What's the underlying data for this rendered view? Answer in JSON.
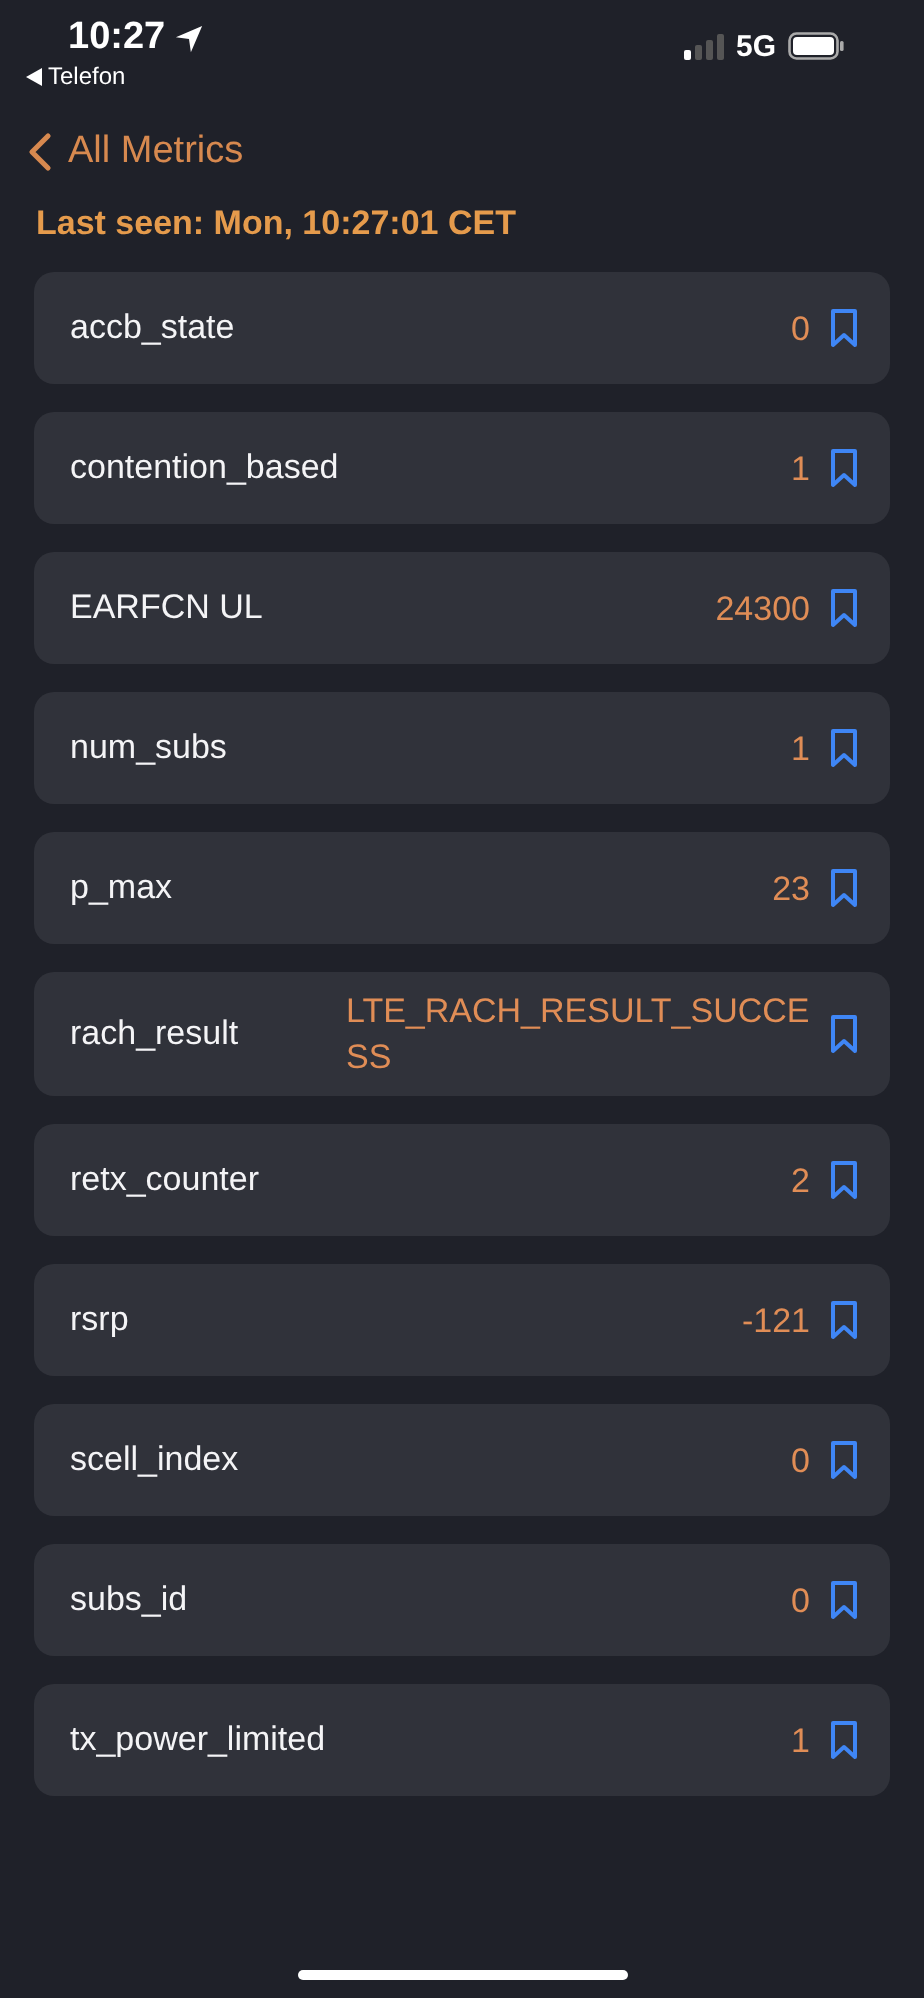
{
  "status_bar": {
    "time": "10:27",
    "back_app": "Telefon",
    "network": "5G"
  },
  "nav": {
    "back_label": "All Metrics"
  },
  "last_seen": "Last seen: Mon, 10:27:01 CET",
  "metrics": [
    {
      "name": "accb_state",
      "value": "0"
    },
    {
      "name": "contention_based",
      "value": "1"
    },
    {
      "name": "EARFCN UL",
      "value": "24300"
    },
    {
      "name": "num_subs",
      "value": "1"
    },
    {
      "name": "p_max",
      "value": "23"
    },
    {
      "name": "rach_result",
      "value": "LTE_RACH_RESULT_SUCCESS"
    },
    {
      "name": "retx_counter",
      "value": "2"
    },
    {
      "name": "rsrp",
      "value": "-121"
    },
    {
      "name": "scell_index",
      "value": "0"
    },
    {
      "name": "subs_id",
      "value": "0"
    },
    {
      "name": "tx_power_limited",
      "value": "1"
    }
  ]
}
